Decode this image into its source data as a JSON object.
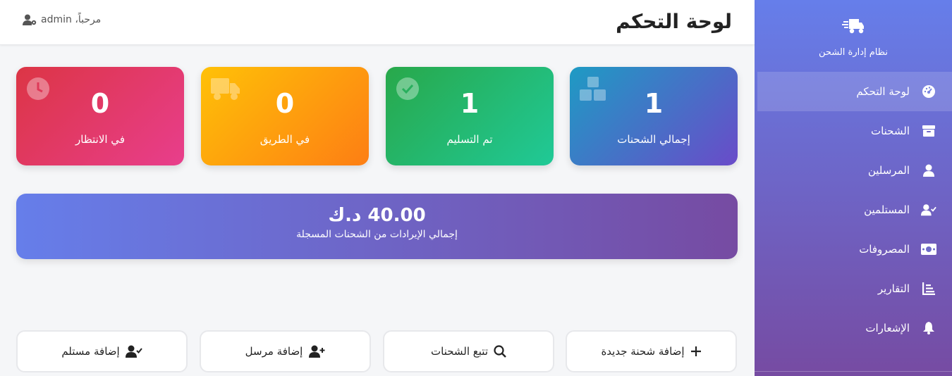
{
  "header": {
    "title": "لوحة التحكم",
    "welcome": "مرحباً، admin"
  },
  "sidebar": {
    "brand": "نظام إدارة الشحن",
    "items": [
      {
        "label": "لوحة التحكم",
        "icon": "dashboard-gauge-icon",
        "active": true
      },
      {
        "label": "الشحنات",
        "icon": "box-icon"
      },
      {
        "label": "المرسلين",
        "icon": "user-icon"
      },
      {
        "label": "المستلمين",
        "icon": "user-check-icon"
      },
      {
        "label": "المصروفات",
        "icon": "money-icon"
      },
      {
        "label": "التقارير",
        "icon": "chart-icon"
      },
      {
        "label": "الإشعارات",
        "icon": "bell-icon"
      }
    ]
  },
  "stats": [
    {
      "value": "1",
      "label": "إجمالي الشحنات",
      "icon": "boxes-icon"
    },
    {
      "value": "1",
      "label": "تم التسليم",
      "icon": "check-circle-icon"
    },
    {
      "value": "0",
      "label": "في الطريق",
      "icon": "truck-icon"
    },
    {
      "value": "0",
      "label": "في الانتظار",
      "icon": "clock-icon"
    }
  ],
  "revenue": {
    "amount": "40.00 د.ك",
    "label": "إجمالي الإيرادات من الشحنات المسجلة"
  },
  "actions": [
    {
      "label": "إضافة شحنة جديدة",
      "icon": "plus-icon"
    },
    {
      "label": "تتبع الشحنات",
      "icon": "search-icon"
    },
    {
      "label": "إضافة مرسل",
      "icon": "user-plus-icon"
    },
    {
      "label": "إضافة مستلم",
      "icon": "user-check-icon"
    }
  ],
  "colors": {
    "sidebar_top": "#667eea",
    "sidebar_bottom": "#764ba2",
    "card_total": "#1e9bc4",
    "card_delivered": "#28a84a",
    "card_transit": "#ffc107",
    "card_pending": "#dc3545"
  }
}
